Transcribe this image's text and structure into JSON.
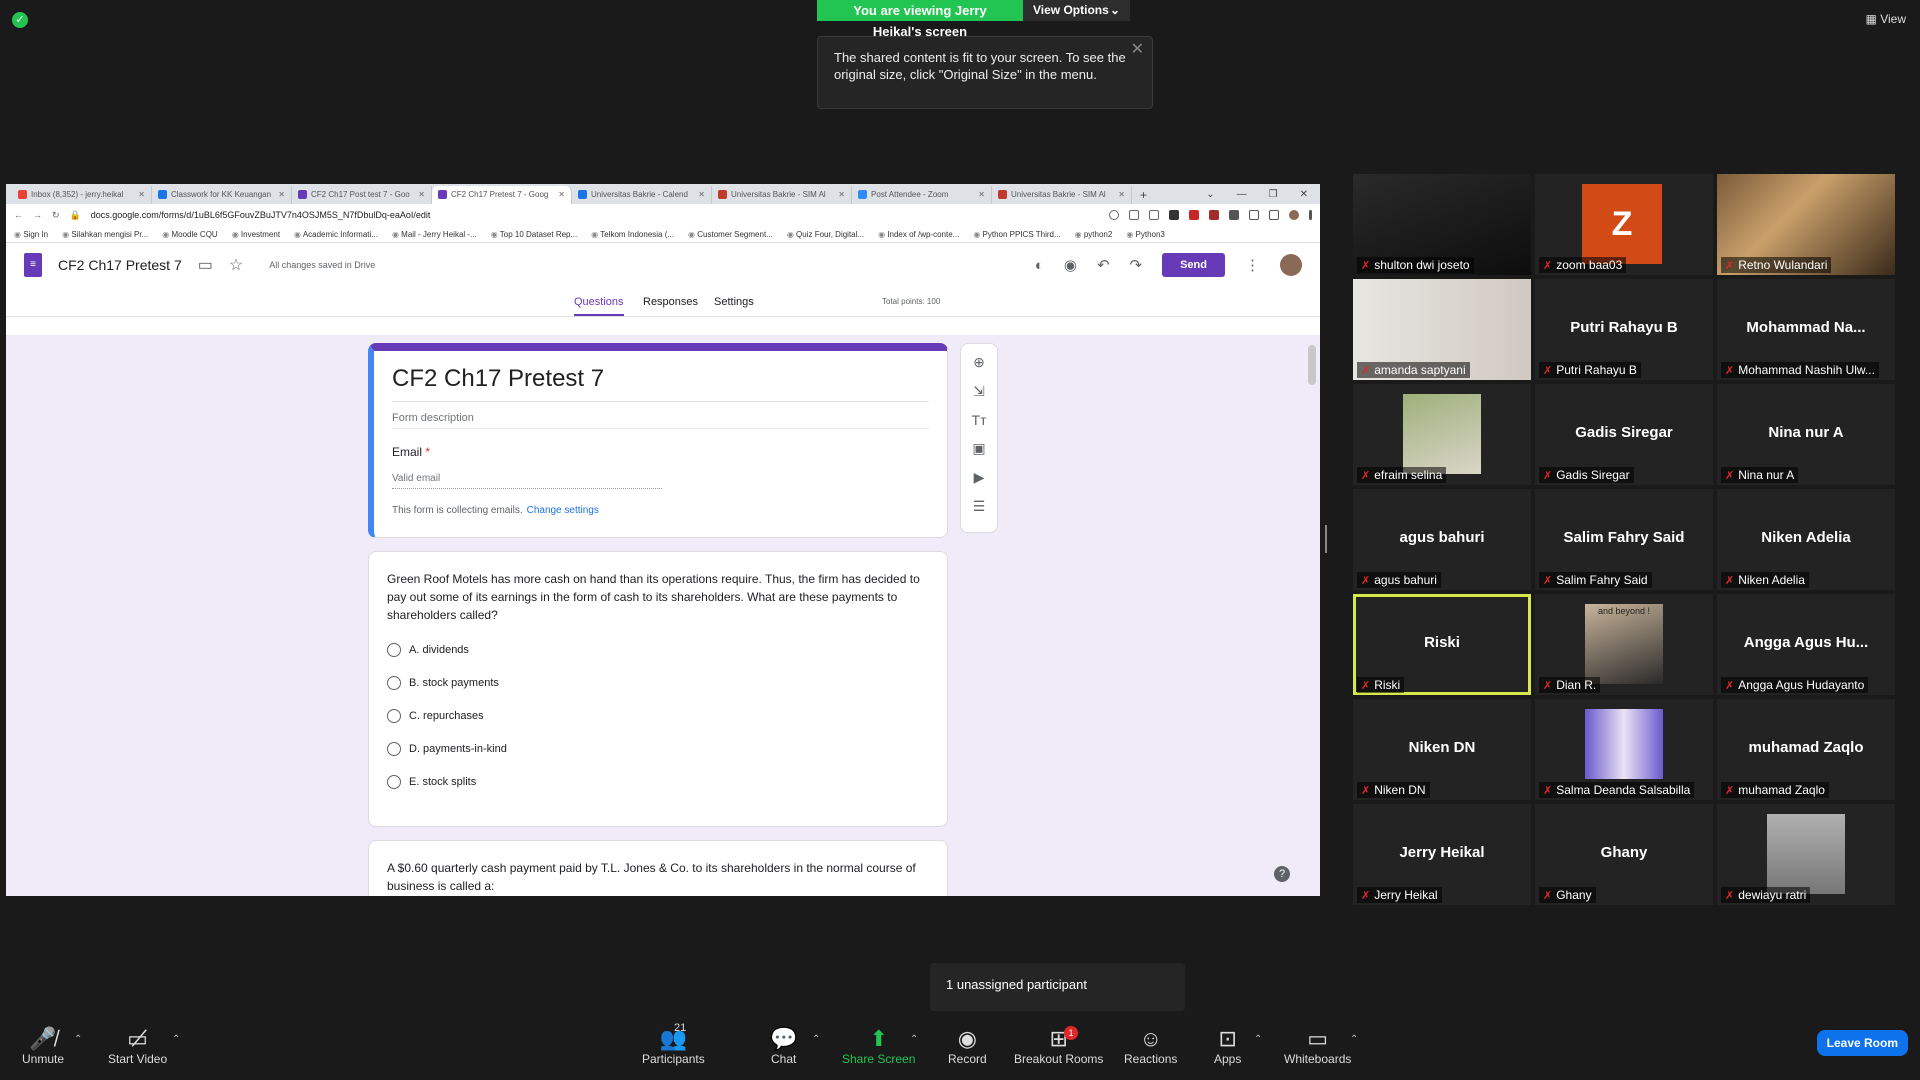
{
  "zoom": {
    "viewing_banner": "You are viewing Jerry Heikal's screen",
    "view_options": "View Options",
    "view_label": "View",
    "tooltip": "The shared content is fit to your screen. To see the original size, click \"Original Size\" in the menu.",
    "unassigned": "1 unassigned participant",
    "participants_count": "21",
    "breakout_badge": "1",
    "toolbar": {
      "unmute": "Unmute",
      "start_video": "Start Video",
      "participants": "Participants",
      "chat": "Chat",
      "share_screen": "Share Screen",
      "record": "Record",
      "breakout_rooms": "Breakout Rooms",
      "reactions": "Reactions",
      "apps": "Apps",
      "whiteboards": "Whiteboards",
      "leave_room": "Leave Room"
    },
    "accent_green": "#23c552",
    "active_speaker_color": "#d6e84c"
  },
  "browser": {
    "tabs": [
      {
        "label": "Inbox (8,352) - jerry.heikal",
        "color": "#ea4335"
      },
      {
        "label": "Classwork for KK Keuangan",
        "color": "#1a73e8"
      },
      {
        "label": "CF2 Ch17 Post test 7 - Goo",
        "color": "#673ab7"
      },
      {
        "label": "CF2 Ch17 Pretest 7 - Goog",
        "color": "#673ab7"
      },
      {
        "label": "Universitas Bakrie - Calend",
        "color": "#1a73e8"
      },
      {
        "label": "Universitas Bakrie - SIM Al",
        "color": "#c0392b"
      },
      {
        "label": "Post Attendee - Zoom",
        "color": "#2d8cff"
      },
      {
        "label": "Universitas Bakrie - SIM Al",
        "color": "#c0392b"
      }
    ],
    "url": "docs.google.com/forms/d/1uBL6f5GFouvZBuJTV7n4OSJM5S_N7fDbulDq-eaAoI/edit",
    "bookmarks": [
      "Sign In",
      "Silahkan mengisi Pr...",
      "Moodle CQU",
      "Investment",
      "Academic Informati...",
      "Mail - Jerry Heikal -...",
      "Top 10 Dataset Rep...",
      "Telkom Indonesia (...",
      "Customer Segment...",
      "Quiz Four, Digital...",
      "Index of /wp-conte...",
      "Python PPICS Third...",
      "python2",
      "Python3"
    ]
  },
  "form": {
    "doc_title": "CF2 Ch17 Pretest 7",
    "saved_status": "All changes saved in Drive",
    "send": "Send",
    "tabs": {
      "questions": "Questions",
      "responses": "Responses",
      "settings": "Settings"
    },
    "total_points": "Total points: 100",
    "title": "CF2 Ch17 Pretest 7",
    "description_placeholder": "Form description",
    "email_label": "Email",
    "email_required": "*",
    "email_placeholder": "Valid email",
    "collecting_note": "This form is collecting emails.",
    "change_settings": "Change settings",
    "q1": {
      "text": "Green Roof Motels has more cash on hand than its operations require. Thus, the firm has decided to pay out some of its earnings in the form of cash to its shareholders. What are these payments to shareholders called?",
      "options": [
        "A. dividends",
        "B. stock payments",
        "C. repurchases",
        "D. payments-in-kind",
        "E. stock splits"
      ]
    },
    "q2_text": "A $0.60 quarterly cash payment paid by T.L. Jones & Co. to its shareholders in the normal course of business is called a:",
    "accent": "#673ab7"
  },
  "participants": [
    {
      "big": "",
      "name": "shulton dwi joseto",
      "kind": "video"
    },
    {
      "big": "",
      "name": "zoom baa03",
      "kind": "letter",
      "letter": "Z"
    },
    {
      "big": "",
      "name": "Retno Wulandari",
      "kind": "image"
    },
    {
      "big": "",
      "name": "amanda saptyani",
      "kind": "video"
    },
    {
      "big": "Putri Rahayu B",
      "name": "Putri Rahayu B",
      "kind": "name"
    },
    {
      "big": "Mohammad  Na...",
      "name": "Mohammad Nashih Ulw...",
      "kind": "name"
    },
    {
      "big": "",
      "name": "efraim selina",
      "kind": "image"
    },
    {
      "big": "Gadis Siregar",
      "name": "Gadis Siregar",
      "kind": "name"
    },
    {
      "big": "Nina nur A",
      "name": "Nina nur A",
      "kind": "name"
    },
    {
      "big": "agus bahuri",
      "name": "agus bahuri",
      "kind": "name"
    },
    {
      "big": "Salim Fahry Said",
      "name": "Salim Fahry Said",
      "kind": "name"
    },
    {
      "big": "Niken Adelia",
      "name": "Niken Adelia",
      "kind": "name"
    },
    {
      "big": "Riski",
      "name": "Riski",
      "kind": "name",
      "active": true
    },
    {
      "big": "",
      "name": "Dian R.",
      "kind": "image",
      "caption": "and beyond !"
    },
    {
      "big": "Angga  Agus  Hu...",
      "name": "Angga Agus Hudayanto",
      "kind": "name"
    },
    {
      "big": "Niken DN",
      "name": "Niken DN",
      "kind": "name"
    },
    {
      "big": "",
      "name": "Salma Deanda Salsabilla",
      "kind": "image"
    },
    {
      "big": "muhamad Zaqlo",
      "name": "muhamad Zaqlo",
      "kind": "name"
    },
    {
      "big": "Jerry Heikal",
      "name": "Jerry Heikal",
      "kind": "name"
    },
    {
      "big": "Ghany",
      "name": "Ghany",
      "kind": "name"
    },
    {
      "big": "",
      "name": "dewiayu ratri",
      "kind": "image"
    }
  ]
}
